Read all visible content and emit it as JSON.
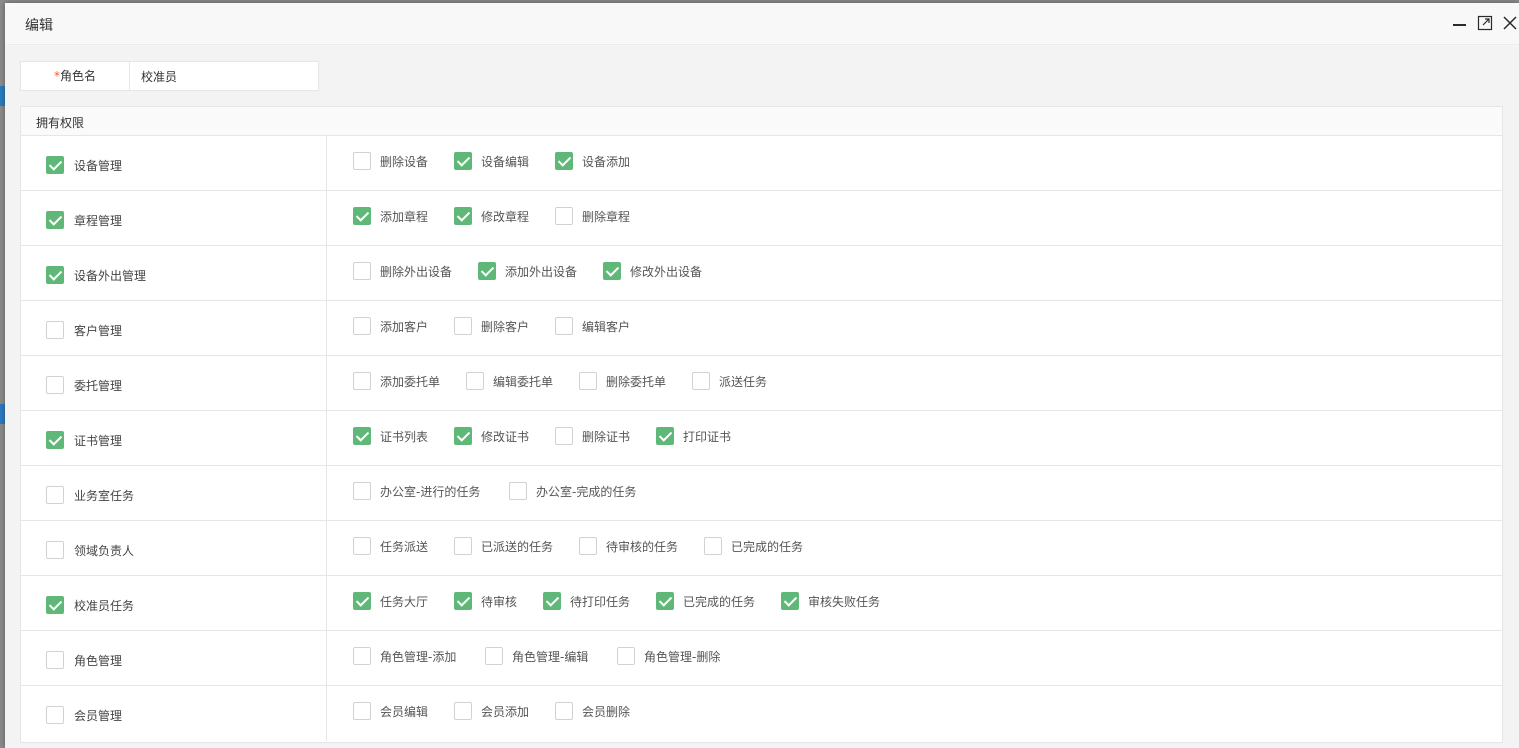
{
  "dialog": {
    "title": "编辑",
    "controls": {
      "minimize_icon": "minimize-icon",
      "maximize_icon": "maximize-icon",
      "close_icon": "close-icon"
    }
  },
  "role_field": {
    "required_mark": "*",
    "label": "角色名",
    "value": "校准员"
  },
  "permissions": {
    "header": "拥有权限",
    "accent_color": "#5fb878",
    "groups": [
      {
        "label": "设备管理",
        "checked": true,
        "options": [
          {
            "label": "删除设备",
            "checked": false
          },
          {
            "label": "设备编辑",
            "checked": true
          },
          {
            "label": "设备添加",
            "checked": true
          }
        ]
      },
      {
        "label": "章程管理",
        "checked": true,
        "options": [
          {
            "label": "添加章程",
            "checked": true
          },
          {
            "label": "修改章程",
            "checked": true
          },
          {
            "label": "删除章程",
            "checked": false
          }
        ]
      },
      {
        "label": "设备外出管理",
        "checked": true,
        "options": [
          {
            "label": "删除外出设备",
            "checked": false
          },
          {
            "label": "添加外出设备",
            "checked": true
          },
          {
            "label": "修改外出设备",
            "checked": true
          }
        ]
      },
      {
        "label": "客户管理",
        "checked": false,
        "options": [
          {
            "label": "添加客户",
            "checked": false
          },
          {
            "label": "删除客户",
            "checked": false
          },
          {
            "label": "编辑客户",
            "checked": false
          }
        ]
      },
      {
        "label": "委托管理",
        "checked": false,
        "options": [
          {
            "label": "添加委托单",
            "checked": false
          },
          {
            "label": "编辑委托单",
            "checked": false
          },
          {
            "label": "删除委托单",
            "checked": false
          },
          {
            "label": "派送任务",
            "checked": false
          }
        ]
      },
      {
        "label": "证书管理",
        "checked": true,
        "options": [
          {
            "label": "证书列表",
            "checked": true
          },
          {
            "label": "修改证书",
            "checked": true
          },
          {
            "label": "删除证书",
            "checked": false
          },
          {
            "label": "打印证书",
            "checked": true
          }
        ]
      },
      {
        "label": "业务室任务",
        "checked": false,
        "options": [
          {
            "label": "办公室-进行的任务",
            "checked": false
          },
          {
            "label": "办公室-完成的任务",
            "checked": false
          }
        ]
      },
      {
        "label": "领域负责人",
        "checked": false,
        "options": [
          {
            "label": "任务派送",
            "checked": false
          },
          {
            "label": "已派送的任务",
            "checked": false
          },
          {
            "label": "待审核的任务",
            "checked": false
          },
          {
            "label": "已完成的任务",
            "checked": false
          }
        ]
      },
      {
        "label": "校准员任务",
        "checked": true,
        "options": [
          {
            "label": "任务大厅",
            "checked": true
          },
          {
            "label": "待审核",
            "checked": true
          },
          {
            "label": "待打印任务",
            "checked": true
          },
          {
            "label": "已完成的任务",
            "checked": true
          },
          {
            "label": "审核失败任务",
            "checked": true
          }
        ]
      },
      {
        "label": "角色管理",
        "checked": false,
        "options": [
          {
            "label": "角色管理-添加",
            "checked": false
          },
          {
            "label": "角色管理-编辑",
            "checked": false
          },
          {
            "label": "角色管理-删除",
            "checked": false
          }
        ]
      },
      {
        "label": "会员管理",
        "checked": false,
        "options": [
          {
            "label": "会员编辑",
            "checked": false
          },
          {
            "label": "会员添加",
            "checked": false
          },
          {
            "label": "会员删除",
            "checked": false
          }
        ]
      }
    ]
  }
}
